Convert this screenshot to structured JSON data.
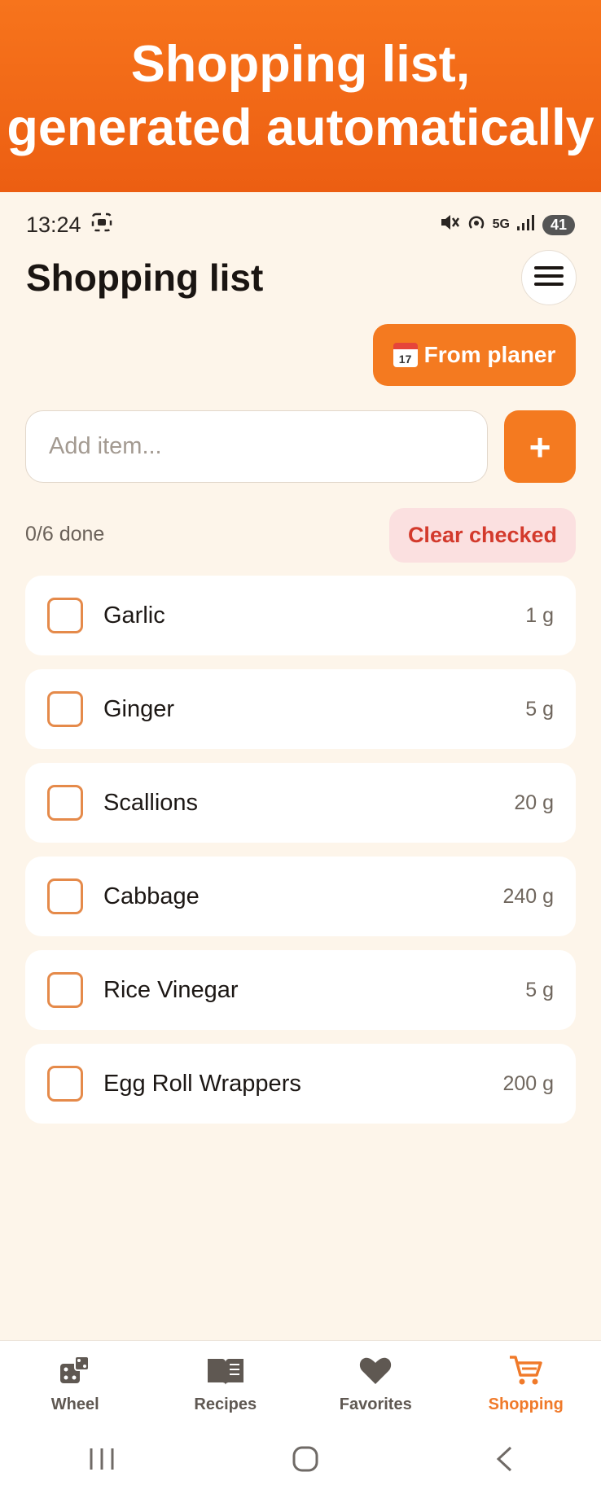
{
  "banner": {
    "line1": "Shopping list,",
    "line2": "generated automatically"
  },
  "statusbar": {
    "time": "13:24",
    "network": "5G",
    "battery": "41"
  },
  "header": {
    "title": "Shopping list"
  },
  "planner_button": {
    "label": "From planer",
    "calendar_day": "17"
  },
  "add_item": {
    "placeholder": "Add item...",
    "value": "",
    "button_label": "+"
  },
  "summary": {
    "done": "0/6 done",
    "clear_label": "Clear checked"
  },
  "items": [
    {
      "name": "Garlic",
      "qty": "1 g",
      "checked": false
    },
    {
      "name": "Ginger",
      "qty": "5 g",
      "checked": false
    },
    {
      "name": "Scallions",
      "qty": "20 g",
      "checked": false
    },
    {
      "name": "Cabbage",
      "qty": "240 g",
      "checked": false
    },
    {
      "name": "Rice Vinegar",
      "qty": "5 g",
      "checked": false
    },
    {
      "name": "Egg Roll Wrappers",
      "qty": "200 g",
      "checked": false
    }
  ],
  "nav": {
    "items": [
      {
        "label": "Wheel",
        "icon": "dice-icon",
        "active": false
      },
      {
        "label": "Recipes",
        "icon": "book-icon",
        "active": false
      },
      {
        "label": "Favorites",
        "icon": "heart-icon",
        "active": false
      },
      {
        "label": "Shopping",
        "icon": "cart-icon",
        "active": true
      }
    ]
  },
  "colors": {
    "accent": "#f47a20",
    "background": "#fdf5ea",
    "danger": "#d33a2c",
    "danger_bg": "#fbe0e0"
  }
}
